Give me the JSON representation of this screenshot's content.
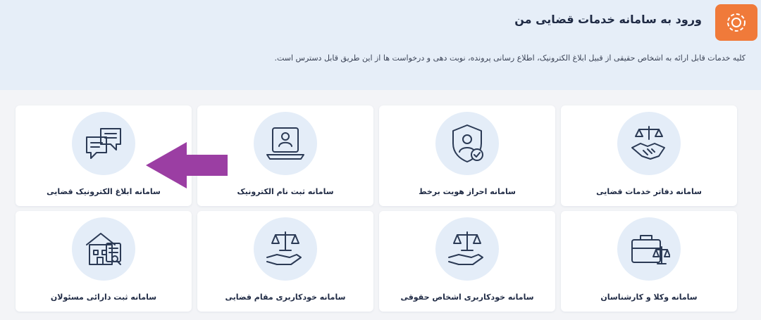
{
  "header": {
    "title": "ورود به سامانه خدمات قضایی من",
    "description": "کلیه خدمات قابل ارائه به اشخاص حقیقی از قبیل ابلاغ الکترونیک، اطلاع رسانی پرونده، نوبت دهی و درخواست ها از این طریق قابل دسترس است.",
    "icon": "gear-icon",
    "icon_color": "#f07a3a"
  },
  "services": [
    {
      "label": "سامانه دفاتر خدمات قضایی",
      "icon": "handshake-scales-icon"
    },
    {
      "label": "سامانه احراز هویت برخط",
      "icon": "shield-user-check-icon"
    },
    {
      "label": "سامانه ثبت نام الکترونیک",
      "icon": "laptop-user-icon"
    },
    {
      "label": "سامانه ابلاغ الکترونیک قضایی",
      "icon": "chat-bubbles-icon"
    },
    {
      "label": "سامانه وکلا و کارشناسان",
      "icon": "briefcase-scales-icon"
    },
    {
      "label": "سامانه خودکاربری اشخاص حقوقی",
      "icon": "hand-scales-icon"
    },
    {
      "label": "سامانه خودکاربری مقام قضایی",
      "icon": "hand-scales-icon"
    },
    {
      "label": "سامانه ثبت دارائی مسئولان",
      "icon": "building-document-icon"
    }
  ],
  "annotation": {
    "icon": "arrow-left-icon",
    "color": "#9b3ea3"
  }
}
